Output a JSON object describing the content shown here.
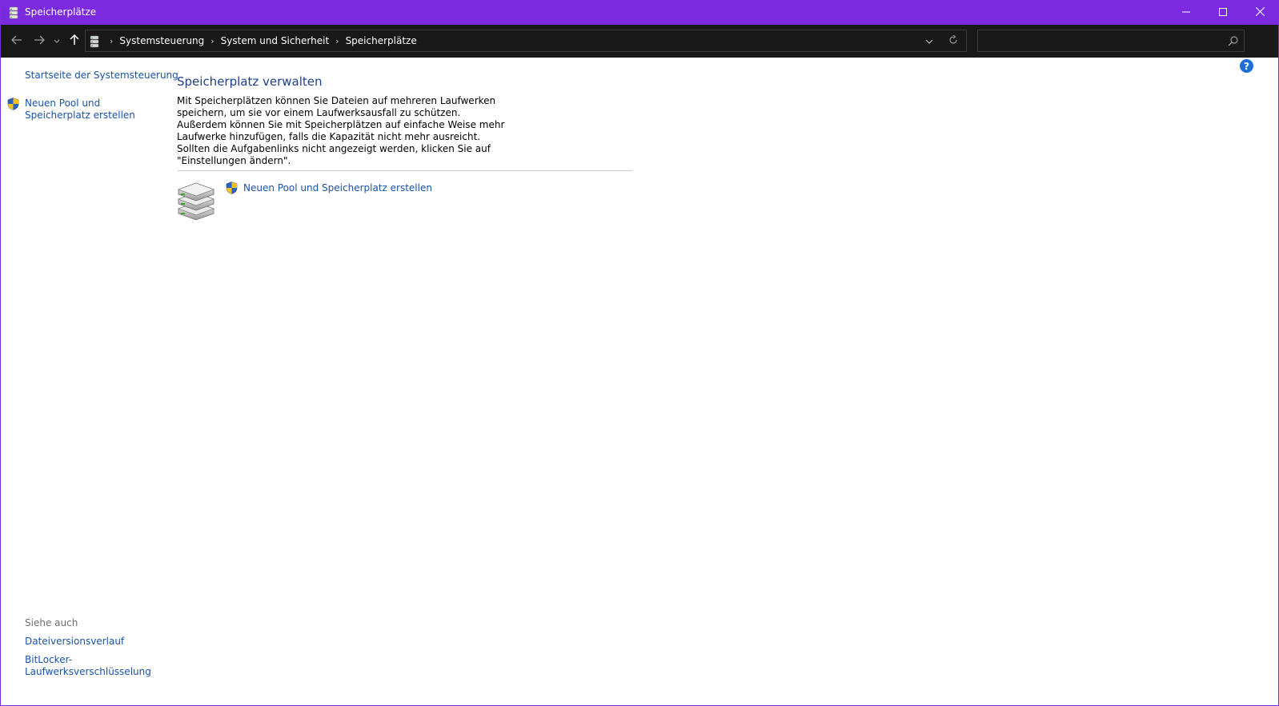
{
  "window": {
    "title": "Speicherplätze",
    "accent_color": "#7b2ae0",
    "app_icon": "storage-spaces-icon"
  },
  "titlebar_buttons": {
    "minimize": "minimize-icon",
    "maximize": "maximize-icon",
    "close": "close-icon"
  },
  "address_bar": {
    "crumbs": [
      "Systemsteuerung",
      "System und Sicherheit",
      "Speicherplätze"
    ]
  },
  "search": {
    "placeholder": ""
  },
  "left_pane": {
    "home_link": "Startseite der Systemsteuerung",
    "new_pool_link": "Neuen Pool und Speicherplatz erstellen",
    "see_also_heading": "Siehe auch",
    "see_also_links": [
      "Dateiversionsverlauf",
      "BitLocker-Laufwerksverschlüsselung"
    ]
  },
  "main": {
    "title": "Speicherplatz verwalten",
    "description": "Mit Speicherplätzen können Sie Dateien auf mehreren Laufwerken speichern, um sie vor einem Laufwerksausfall zu schützen. Außerdem können Sie mit Speicherplätzen auf einfache Weise mehr Laufwerke hinzufügen, falls die Kapazität nicht mehr ausreicht. Sollten die Aufgabenlinks nicht angezeigt werden, klicken Sie auf \"Einstellungen ändern\".",
    "task_link": "Neuen Pool und Speicherplatz erstellen"
  },
  "help": {
    "label": "?"
  }
}
